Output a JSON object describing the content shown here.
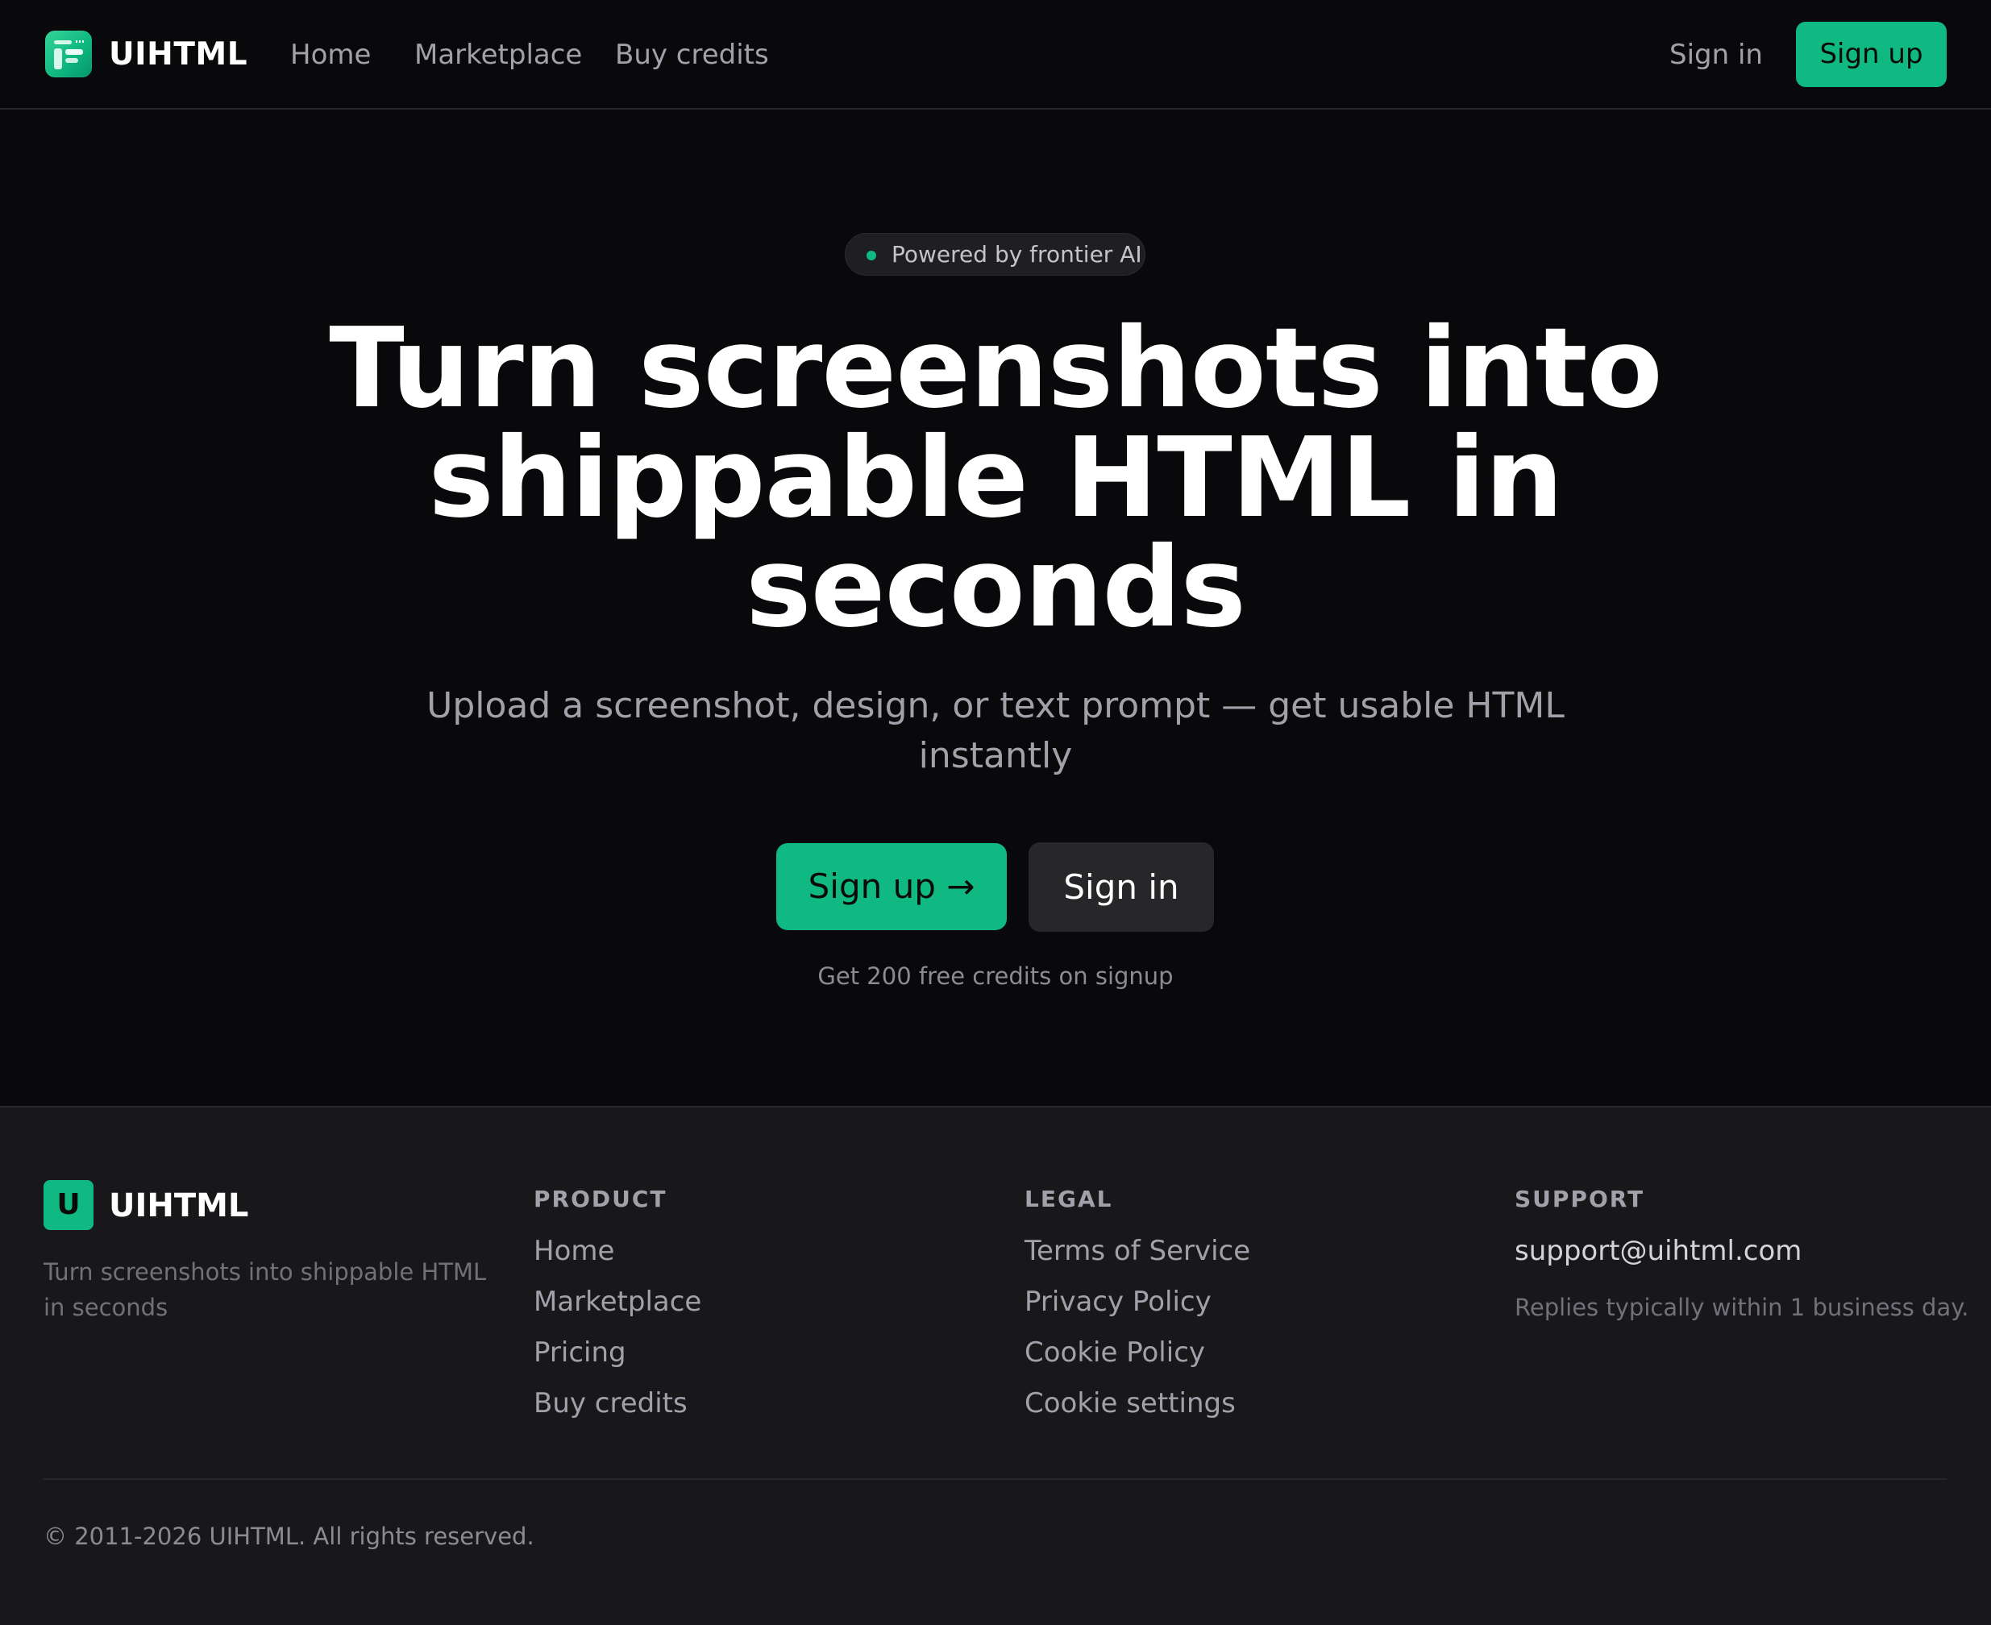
{
  "header": {
    "brand": "UIHTML",
    "nav": [
      "Home",
      "Marketplace",
      "Buy credits"
    ],
    "sign_in": "Sign in",
    "sign_up": "Sign up"
  },
  "hero": {
    "badge": "Powered by frontier AI",
    "title_lines": [
      "Turn screenshots into",
      "shippable HTML in",
      "seconds"
    ],
    "subtitle_lines": [
      "Upload a screenshot, design, or text prompt — get usable HTML",
      "instantly"
    ],
    "cta_primary": "Sign up →",
    "cta_secondary": "Sign in",
    "note": "Get 200 free credits on signup"
  },
  "footer": {
    "logo_letter": "U",
    "brand": "UIHTML",
    "tagline": "Turn screenshots into shippable HTML in seconds",
    "product": {
      "heading": "PRODUCT",
      "links": [
        "Home",
        "Marketplace",
        "Pricing",
        "Buy credits"
      ]
    },
    "legal": {
      "heading": "LEGAL",
      "links": [
        "Terms of Service",
        "Privacy Policy",
        "Cookie Policy",
        "Cookie settings"
      ]
    },
    "support": {
      "heading": "SUPPORT",
      "email": "support@uihtml.com",
      "note": "Replies typically within 1 business day."
    },
    "copyright": "© 2011-2026 UIHTML. All rights reserved."
  },
  "colors": {
    "accent": "#10b981",
    "background": "#09090b",
    "footer_background": "#18181b"
  }
}
